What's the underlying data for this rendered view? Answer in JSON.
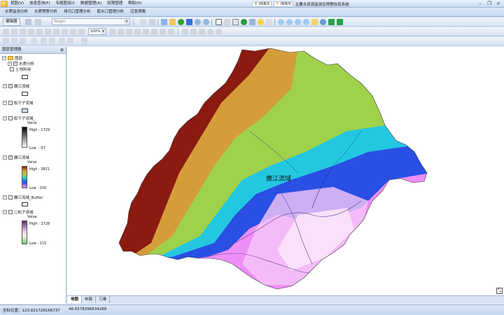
{
  "menu": {
    "items": [
      "视图(V)",
      "信息查询(F)",
      "专题图设计",
      "数据管理(A)",
      "权限管理",
      "帮助(H)"
    ]
  },
  "window": {
    "status_1": "0KB/S",
    "status_2": "0KB/S",
    "title": "主要水资源监测及预警信息系统"
  },
  "ribbon": {
    "tabs": [
      "水质监测分析",
      "水质预警分析",
      "排污口管理分析",
      "取水口管理分析",
      "应急预案"
    ]
  },
  "toolbar": {
    "edit_menu": "编辑器",
    "target_label": "Target:",
    "scale_value": "100%"
  },
  "layer_panel": {
    "title": "图层管理器",
    "root": "图层",
    "group": "水质分析",
    "layers": [
      {
        "name": "土地利用",
        "checked": false
      },
      {
        "name": "嫩江流域",
        "checked": true
      },
      {
        "name": "松干子流域",
        "checked": false
      },
      {
        "name": "松干子流域_",
        "checked": false,
        "value_label": "Value",
        "high": "High : 1729",
        "low": "Low : -57"
      },
      {
        "name": "嫩江流域",
        "checked": true,
        "value_label": "Value",
        "high": "High : 3821",
        "low": "Low : 100"
      },
      {
        "name": "嫩江流域_Buffer",
        "checked": false
      },
      {
        "name": "二松子流域",
        "checked": false,
        "value_label": "Value",
        "high": "High : 2728",
        "low": "Low : 115"
      }
    ],
    "colors": {
      "landuse_swatch": "#ffffff",
      "nenjiang_swatch": "#ffffff",
      "songgan_swatch": "#cfe9f5",
      "buffer_swatch": "#ffffff"
    }
  },
  "map": {
    "basin_label": "嫩江流域",
    "colors": {
      "high": "#8b1a10",
      "mid_high": "#d59d3a",
      "mid": "#9fd24a",
      "mid_low": "#23c7e0",
      "low_blue": "#2a4fe4",
      "lowest": "#f08ef7"
    }
  },
  "view_tabs": [
    "地图",
    "布局",
    "三维"
  ],
  "status": {
    "coord_label": "坐标位置：123.821728166737",
    "coord_y": "46.6578396634288"
  }
}
